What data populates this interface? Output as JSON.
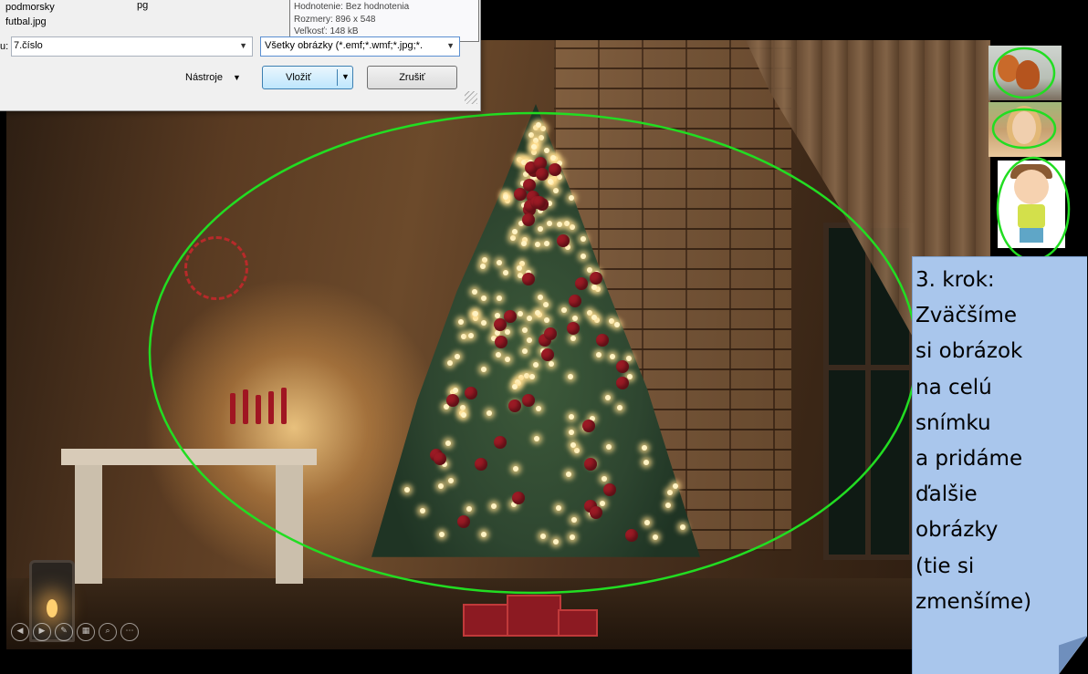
{
  "file_dialog": {
    "file_list": [
      "podmorsky",
      "futbal.jpg"
    ],
    "partial_extension": "pg",
    "tooltip": {
      "rating": "Hodnotenie: Bez hodnotenia",
      "dimensions": "Rozmery: 896 x 548",
      "size": "Veľkosť: 148 kB"
    },
    "filename_label": "u:",
    "filename_value": "7.číslo",
    "filetype_value": "Všetky obrázky (*.emf;*.wmf;*.jpg;*.",
    "tools_label": "Nástroje",
    "insert_label": "Vložiť",
    "cancel_label": "Zrušiť"
  },
  "slideshow": {
    "controls": [
      {
        "icon": "previous-icon",
        "glyph": "◀"
      },
      {
        "icon": "next-icon",
        "glyph": "▶"
      },
      {
        "icon": "pen-icon",
        "glyph": "✎"
      },
      {
        "icon": "slides-icon",
        "glyph": "▦"
      },
      {
        "icon": "zoom-icon",
        "glyph": "⌕"
      },
      {
        "icon": "more-icon",
        "glyph": "⋯"
      }
    ]
  },
  "thumbnails": [
    "squirrel-picture",
    "girl-picture",
    "cartoon-boy-picture"
  ],
  "callout": {
    "text": "3. krok:\nZväčšíme\nsi obrázok\nna celú\nsnímku\na pridáme\nďalšie\nobrázky\n(tie si\nzmenšíme)"
  },
  "colors": {
    "highlight": "#22dd22",
    "callout_fill": "#a9c6ec",
    "callout_fold": "#6f8fbd"
  }
}
